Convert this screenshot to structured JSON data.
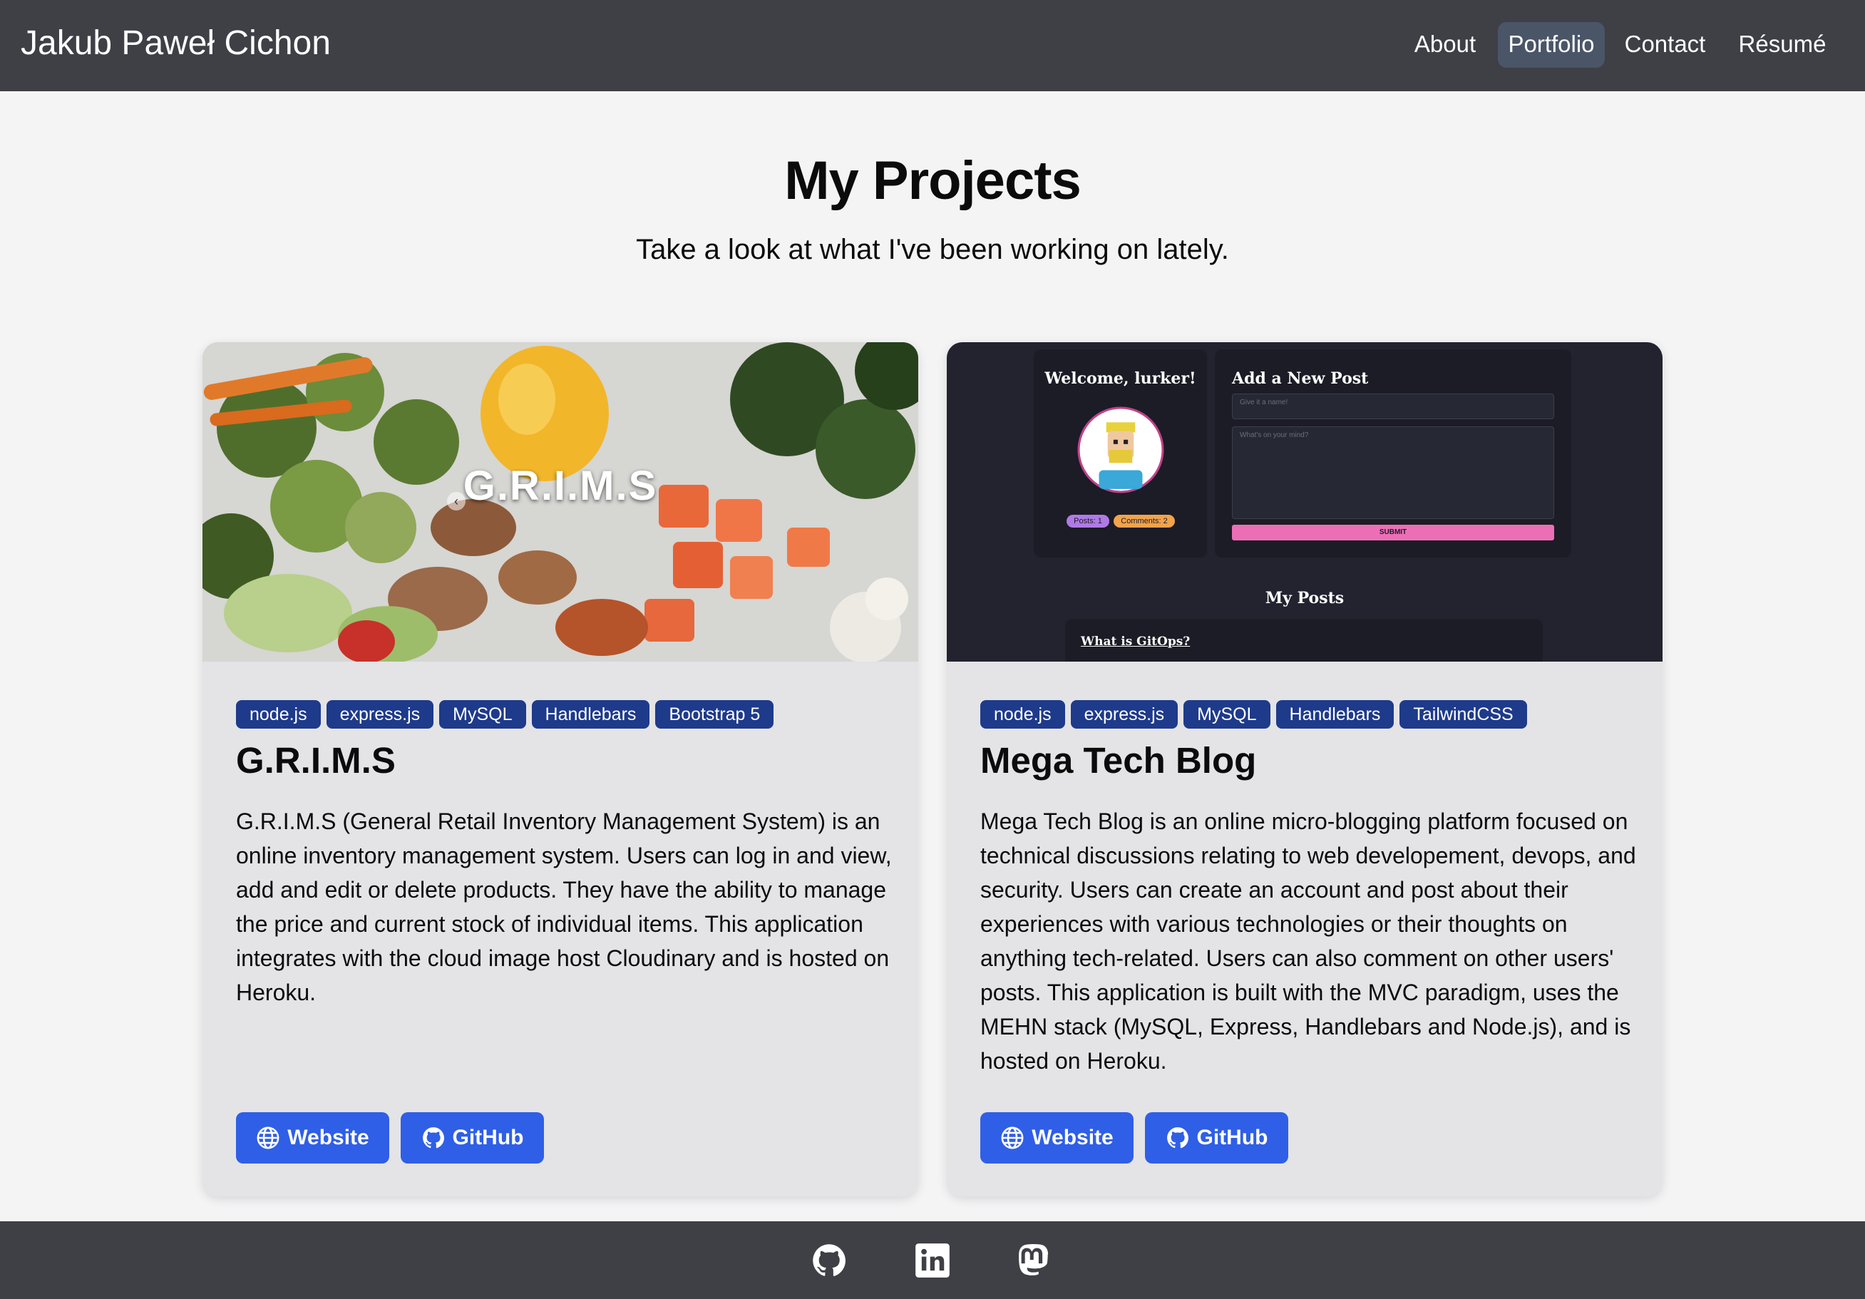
{
  "header": {
    "brand": "Jakub Paweł Cichon",
    "nav": [
      {
        "label": "About",
        "active": false
      },
      {
        "label": "Portfolio",
        "active": true
      },
      {
        "label": "Contact",
        "active": false
      },
      {
        "label": "Résumé",
        "active": false
      }
    ]
  },
  "hero": {
    "title": "My Projects",
    "subtitle": "Take a look at what I've been working on lately."
  },
  "projects": [
    {
      "image_overlay": "G.R.I.M.S",
      "tags": [
        "node.js",
        "express.js",
        "MySQL",
        "Handlebars",
        "Bootstrap 5"
      ],
      "title": "G.R.I.M.S",
      "description": "G.R.I.M.S (General Retail Inventory Management System) is an online inventory management system. Users can log in and view, add and edit or delete products. They have the ability to manage the price and current stock of individual items. This application integrates with the cloud image host Cloudinary and is hosted on Heroku.",
      "website_label": "Website",
      "github_label": "GitHub"
    },
    {
      "preview": {
        "welcome": "Welcome, lurker!",
        "posts_badge": "Posts: 1",
        "comments_badge": "Comments: 2",
        "new_post_heading": "Add a New Post",
        "name_placeholder": "Give it a name!",
        "body_placeholder": "What's on your mind?",
        "submit_label": "SUBMIT",
        "my_posts_heading": "My Posts",
        "post_title": "What is GitOps?"
      },
      "tags": [
        "node.js",
        "express.js",
        "MySQL",
        "Handlebars",
        "TailwindCSS"
      ],
      "title": "Mega Tech Blog",
      "description": "Mega Tech Blog is an online micro-blogging platform focused on technical discussions relating to web developement, devops, and security. Users can create an account and post about their experiences with various technologies or their thoughts on anything tech-related. Users can also comment on other users' posts. This application is built with the MVC paradigm, uses the MEHN stack (MySQL, Express, Handlebars and Node.js), and is hosted on Heroku.",
      "website_label": "Website",
      "github_label": "GitHub"
    }
  ],
  "footer": {
    "icons": [
      "github-icon",
      "linkedin-icon",
      "mastodon-icon"
    ]
  },
  "colors": {
    "header_bg": "#3f3f46",
    "tag_bg": "#1e3a8a",
    "button_bg": "#2f5fe6",
    "card_bg": "#e4e4e7"
  }
}
